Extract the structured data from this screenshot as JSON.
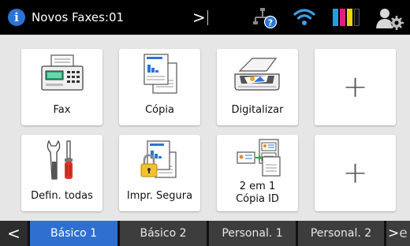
{
  "status_bar": {
    "info_icon": "info-icon",
    "info_symbol": "i",
    "fax_status": "Novos Faxes:01",
    "nav_arrow": ">",
    "network_icon": "wired-network-help-icon",
    "wifi_icon": "wifi-icon",
    "ink_colors": [
      "#1ea0e6",
      "#e01f7f",
      "#f1d20c",
      "#111111"
    ],
    "user_icon": "user-settings-icon"
  },
  "tiles": [
    {
      "icon": "fax-machine-icon",
      "label": "Fax"
    },
    {
      "icon": "copy-document-icon",
      "label": "Cópia"
    },
    {
      "icon": "scanner-icon",
      "label": "Digitalizar"
    },
    {
      "icon": "plus-icon",
      "label": "+"
    },
    {
      "icon": "tools-icon",
      "label": "Defin. todas"
    },
    {
      "icon": "secure-print-icon",
      "label": "Impr. Segura"
    },
    {
      "icon": "id-copy-icon",
      "label_line1": "2 em 1",
      "label_line2": "Cópia ID"
    },
    {
      "icon": "plus-icon",
      "label": "+"
    }
  ],
  "tabbar": {
    "left_arrow": "<",
    "tabs": [
      "Básico 1",
      "Básico 2",
      "Personal. 1",
      "Personal. 2"
    ],
    "active_tab": "Básico 1",
    "right_arrow": ">",
    "right_peek": "e"
  },
  "colors": {
    "active_tab": "#2f6fd0",
    "tab": "#3d3d3d",
    "grid_background": "#e6e6e6"
  }
}
